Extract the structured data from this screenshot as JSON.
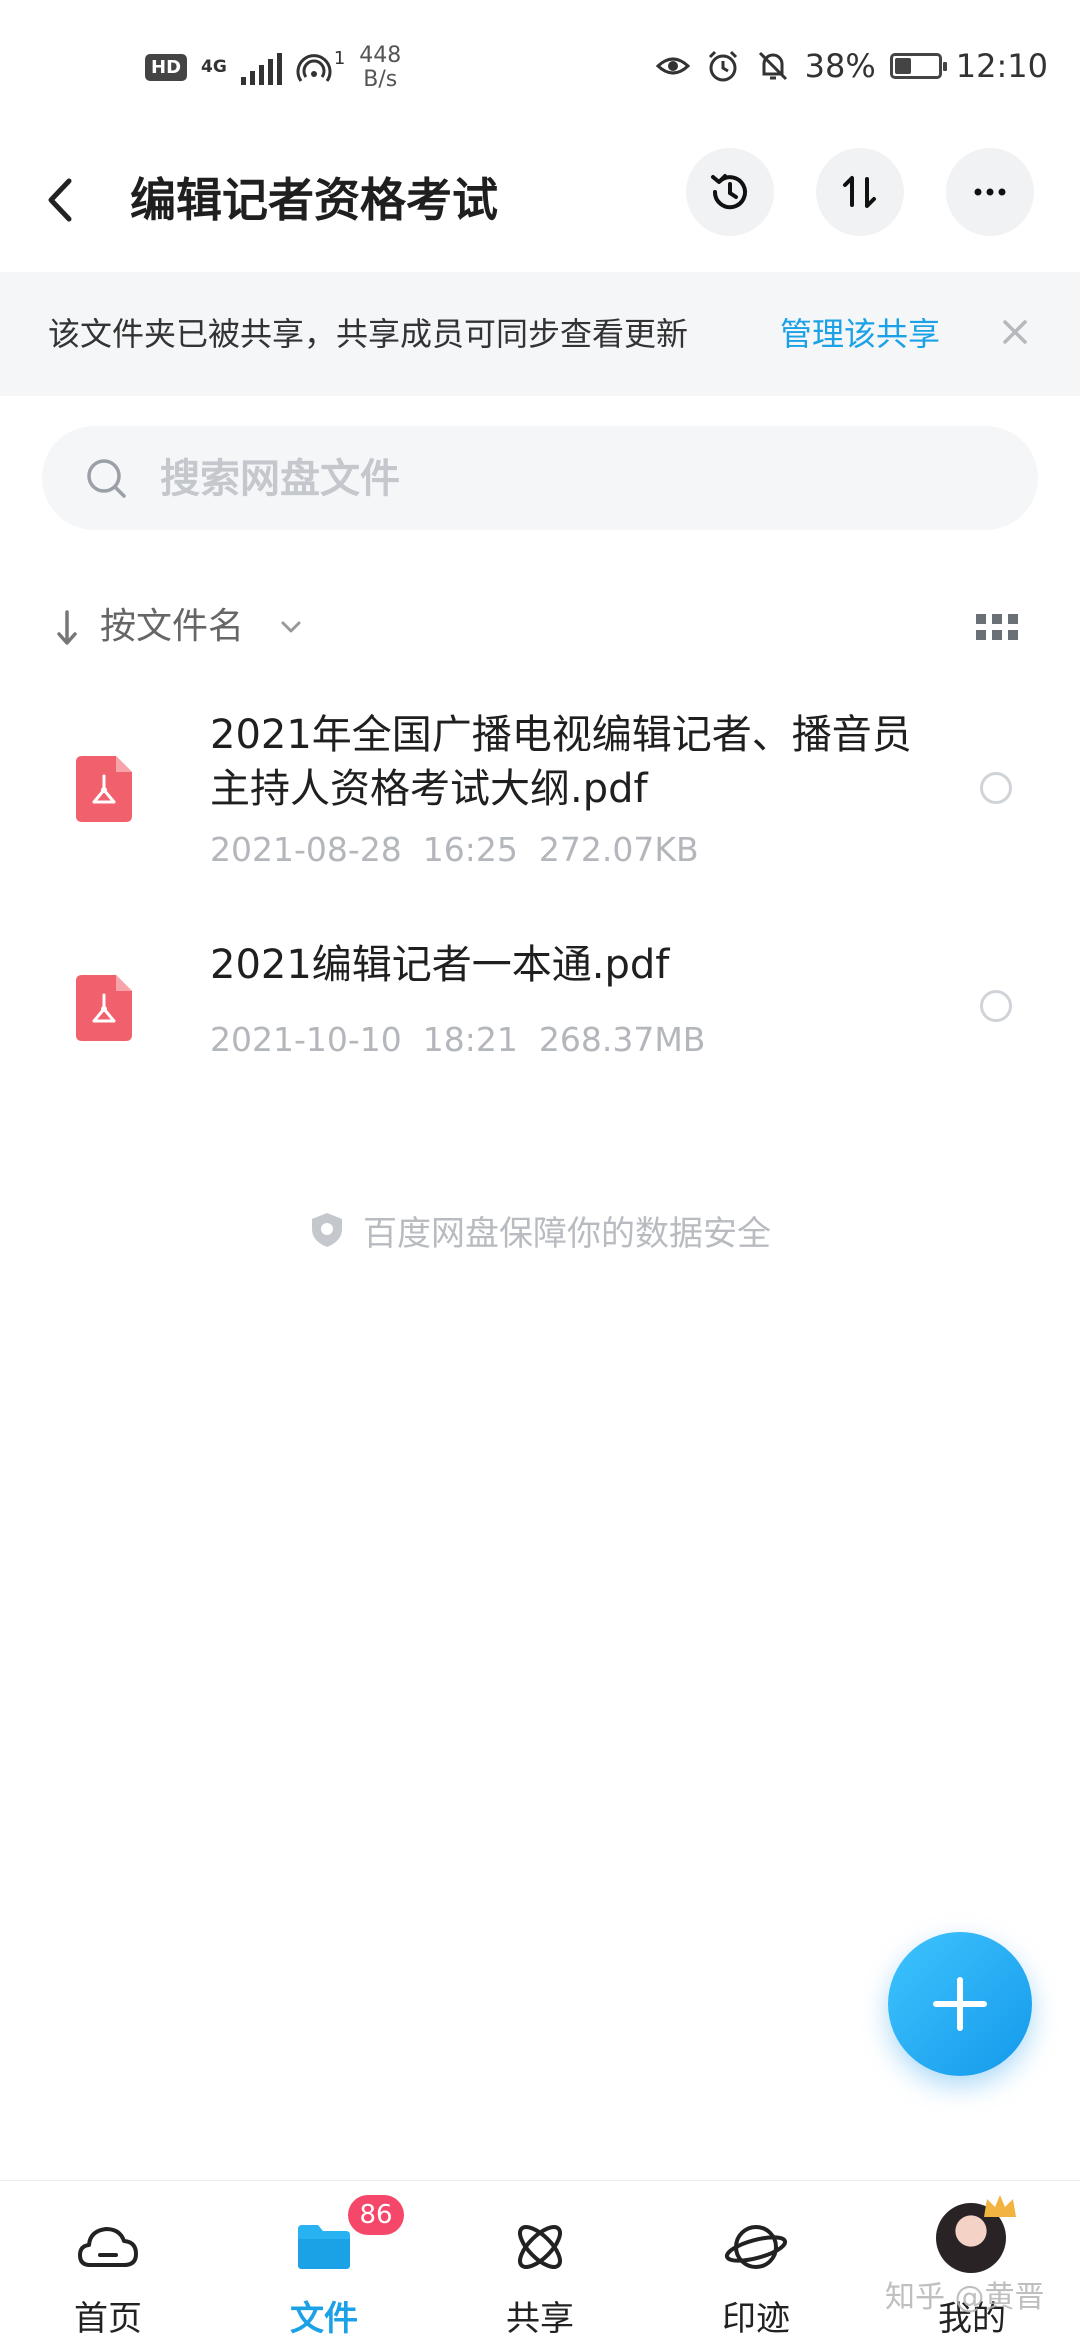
{
  "status_bar": {
    "hd": "HD",
    "network": "4G",
    "hotspot_count": "1",
    "speed_value": "448",
    "speed_unit": "B/s",
    "battery": "38%",
    "battery_level": 0.38,
    "time": "12:10"
  },
  "header": {
    "title": "编辑记者资格考试",
    "icons": [
      "back-icon",
      "history-icon",
      "transfer-icon",
      "more-icon"
    ]
  },
  "share_banner": {
    "text": "该文件夹已被共享，共享成员可同步查看更新",
    "link": "管理该共享"
  },
  "search": {
    "placeholder": "搜索网盘文件"
  },
  "sort": {
    "label": "按文件名"
  },
  "files": [
    {
      "name": "2021年全国广播电视编辑记者、播音员主持人资格考试大纲.pdf",
      "date": "2021-08-28",
      "time": "16:25",
      "size": "272.07KB"
    },
    {
      "name": "2021编辑记者一本通.pdf",
      "date": "2021-10-10",
      "time": "18:21",
      "size": "268.37MB"
    }
  ],
  "secure_note": "百度网盘保障你的数据安全",
  "bottom_nav": {
    "items": [
      {
        "label": "首页",
        "icon": "home-cloud-icon"
      },
      {
        "label": "文件",
        "icon": "folder-icon"
      },
      {
        "label": "共享",
        "icon": "share-atom-icon"
      },
      {
        "label": "印迹",
        "icon": "planet-icon"
      },
      {
        "label": "我的",
        "icon": "avatar"
      }
    ],
    "share_badge": "86",
    "active": "文件"
  },
  "watermark": "知乎 @黄晋",
  "colors": {
    "accent": "#1aa1e6",
    "pdf": "#f0606d",
    "badge": "#f5476a"
  }
}
